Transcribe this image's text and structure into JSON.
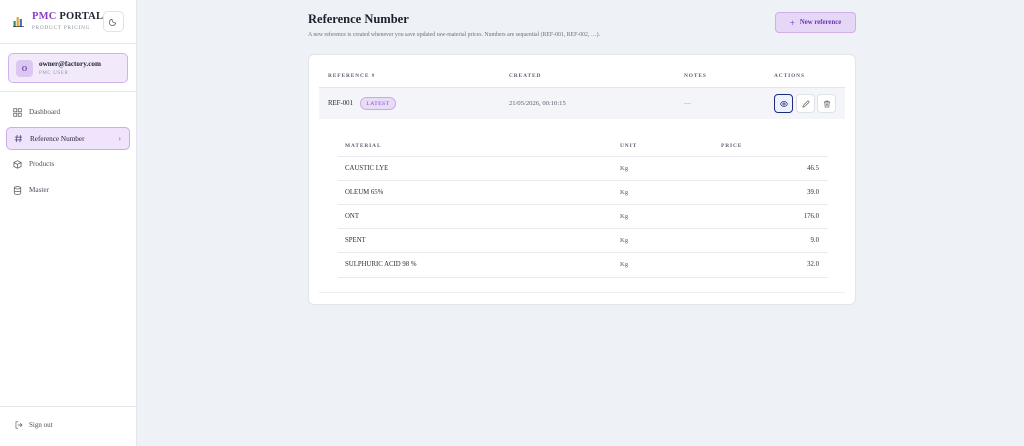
{
  "brand": {
    "title_accent": "PMC",
    "title_rest": " PORTAL",
    "subtitle": "PRODUCT PRICING"
  },
  "user": {
    "initial": "O",
    "email": "owner@factory.com",
    "role": "PMC USER"
  },
  "nav": {
    "items": [
      {
        "label": "Dashboard",
        "icon": "grid-icon",
        "active": false
      },
      {
        "label": "Reference Number",
        "icon": "hash-icon",
        "active": true
      },
      {
        "label": "Products",
        "icon": "box-icon",
        "active": false
      },
      {
        "label": "Master",
        "icon": "database-icon",
        "active": false
      }
    ],
    "chevron": "›"
  },
  "signout": {
    "label": "Sign out"
  },
  "page": {
    "title": "Reference Number",
    "description": "A new reference is created whenever you save updated raw-material prices. Numbers are sequential (REF-001, REF-002, …).",
    "new_button": "New reference",
    "new_button_icon": "+"
  },
  "table": {
    "headers": {
      "reference": "REFERENCE #",
      "created": "CREATED",
      "notes": "NOTES",
      "actions": "ACTIONS"
    },
    "rows": [
      {
        "reference": "REF-001",
        "badge": "LATEST",
        "created": "21/05/2026, 00:10:15",
        "notes": "—"
      }
    ]
  },
  "materials": {
    "headers": {
      "material": "MATERIAL",
      "unit": "UNIT",
      "price": "PRICE"
    },
    "rows": [
      {
        "material": "CAUSTIC LYE",
        "unit": "Kg",
        "price": "46.5"
      },
      {
        "material": "OLEUM 65%",
        "unit": "Kg",
        "price": "39.0"
      },
      {
        "material": "ONT",
        "unit": "Kg",
        "price": "176.0"
      },
      {
        "material": "SPENT",
        "unit": "Kg",
        "price": "9.0"
      },
      {
        "material": "SULPHURIC ACID 98 %",
        "unit": "Kg",
        "price": "32.0"
      }
    ]
  },
  "colors": {
    "accent": "#8c3fc7",
    "active_bg": "#efe4fb",
    "view_border": "#1d2b7a"
  }
}
